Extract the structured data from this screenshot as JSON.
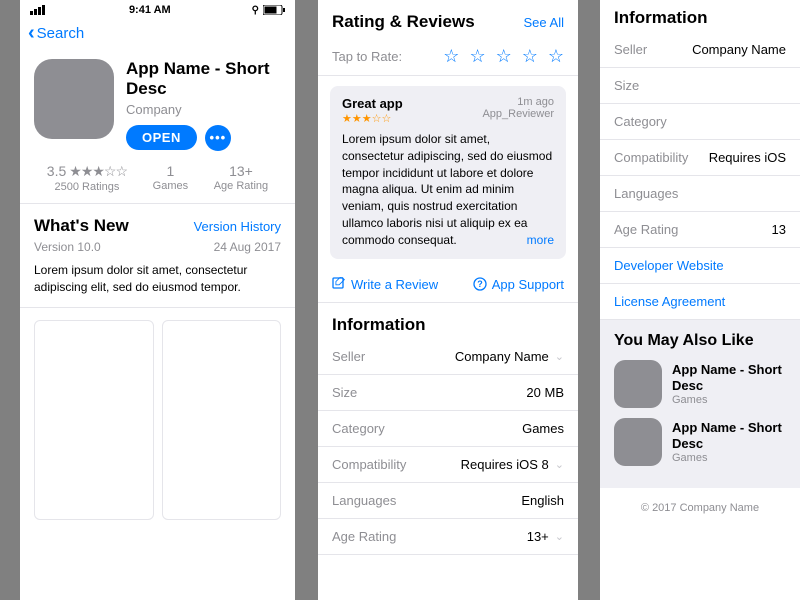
{
  "statusBar": {
    "time": "9:41 AM"
  },
  "nav": {
    "backLabel": "Search"
  },
  "app": {
    "title": "App Name - Short Desc",
    "company": "Company",
    "openLabel": "OPEN"
  },
  "meta": {
    "ratingValue": "3.5",
    "ratingStars": "★★★☆☆",
    "ratingCount": "2500 Ratings",
    "categoryNum": "1",
    "categoryLabel": "Games",
    "ageValue": "13+",
    "ageLabel": "Age Rating"
  },
  "whatsNew": {
    "title": "What's New",
    "historyLink": "Version History",
    "version": "Version 10.0",
    "date": "24 Aug 2017",
    "body": "Lorem ipsum dolor sit amet, consectetur adipiscing elit, sed do eiusmod tempor."
  },
  "reviews": {
    "title": "Rating & Reviews",
    "seeAll": "See All",
    "tapToRate": "Tap to Rate:",
    "card": {
      "title": "Great app",
      "time": "1m ago",
      "author": "App_Reviewer",
      "stars": "★★★☆☆",
      "body": "Lorem ipsum dolor sit amet, consectetur adipiscing, sed do eiusmod tempor incididunt ut labore et dolore magna aliqua. Ut enim ad minim veniam, quis nostrud exercitation ullamco laboris nisi ut aliquip ex ea commodo consequat.",
      "more": "more"
    },
    "writeReview": "Write a Review",
    "appSupport": "App Support"
  },
  "information": {
    "title": "Information",
    "rows": {
      "seller": {
        "label": "Seller",
        "value": "Company Name"
      },
      "size": {
        "label": "Size",
        "value": "20 MB"
      },
      "category": {
        "label": "Category",
        "value": "Games"
      },
      "compatibility": {
        "label": "Compatibility",
        "value": "Requires iOS 8"
      },
      "languages": {
        "label": "Languages",
        "value": "English"
      },
      "ageRating": {
        "label": "Age Rating",
        "value": "13+"
      }
    },
    "links": {
      "devWebsite": "Developer Website",
      "license": "License Agreement"
    }
  },
  "information3": {
    "seller": {
      "label": "Seller",
      "value": "Company Name"
    },
    "size": {
      "label": "Size",
      "value": ""
    },
    "category": {
      "label": "Category",
      "value": ""
    },
    "compatibility": {
      "label": "Compatibility",
      "value": "Requires iOS"
    },
    "languages": {
      "label": "Languages",
      "value": ""
    },
    "ageRating": {
      "label": "Age Rating",
      "value": "13"
    }
  },
  "ymal": {
    "title": "You May Also Like",
    "items": [
      {
        "name": "App Name - Short Desc",
        "category": "Games"
      },
      {
        "name": "App Name - Short Desc",
        "category": "Games"
      }
    ]
  },
  "footer": {
    "copyright": "© 2017 Company Name"
  }
}
